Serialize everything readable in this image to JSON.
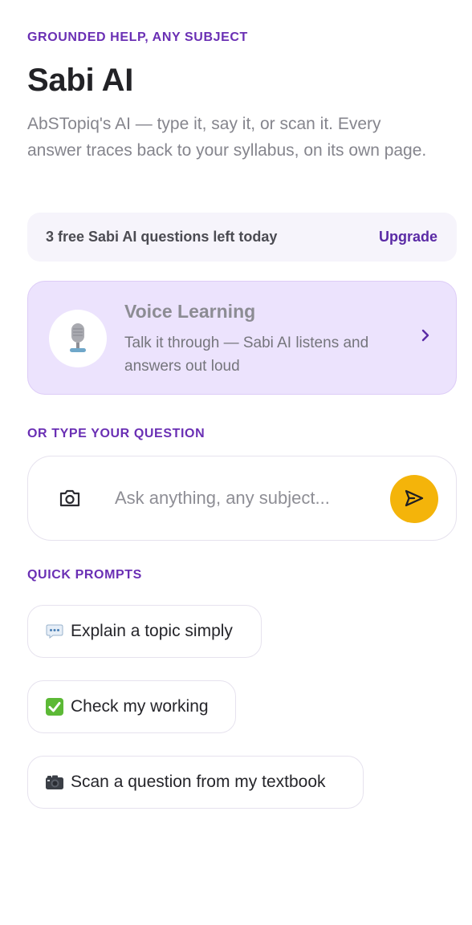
{
  "header": {
    "eyebrow": "GROUNDED HELP, ANY SUBJECT",
    "title": "Sabi AI",
    "subtitle": "AbSTopiq's AI — type it, say it, or scan it. Every answer traces back to your syllabus, on its own page."
  },
  "quota": {
    "text": "3 free Sabi AI questions left today",
    "upgrade_label": "Upgrade"
  },
  "voice": {
    "title": "Voice Learning",
    "description": "Talk it through — Sabi AI listens and answers out loud",
    "icon": "microphone-icon",
    "chevron_icon": "chevron-right-icon"
  },
  "ask": {
    "eyebrow": "OR TYPE YOUR QUESTION",
    "placeholder": "Ask anything, any subject...",
    "value": "",
    "camera_icon": "camera-icon",
    "send_icon": "send-icon"
  },
  "quick_prompts": {
    "eyebrow": "QUICK PROMPTS",
    "items": [
      {
        "icon": "speech-bubble-icon",
        "label": "Explain a topic simply"
      },
      {
        "icon": "check-mark-icon",
        "label": "Check my working"
      },
      {
        "icon": "camera-icon",
        "label": "Scan a question from my textbook"
      }
    ]
  },
  "colors": {
    "accent": "#6a2fb4",
    "voice_card_bg": "#ece3fd",
    "send_button": "#f4b40a",
    "quota_bg": "#f6f4fb"
  }
}
